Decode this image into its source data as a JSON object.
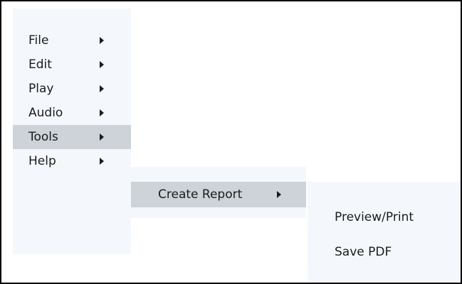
{
  "menu": {
    "items": [
      {
        "label": "File",
        "has_submenu": true
      },
      {
        "label": "Edit",
        "has_submenu": true
      },
      {
        "label": "Play",
        "has_submenu": true
      },
      {
        "label": "Audio",
        "has_submenu": true
      },
      {
        "label": "Tools",
        "has_submenu": true,
        "active": true
      },
      {
        "label": "Help",
        "has_submenu": true
      }
    ]
  },
  "tools_submenu": {
    "items": [
      {
        "label": "Create Report",
        "has_submenu": true,
        "active": true
      }
    ]
  },
  "report_submenu": {
    "items": [
      {
        "label": "Preview/Print"
      },
      {
        "label": "Save PDF"
      }
    ]
  },
  "colors": {
    "menu_bg": "#f4f8fc",
    "highlight": "#cdd3d8",
    "frame_border": "#000000"
  },
  "icons": {
    "submenu_indicator": "caret-right-icon"
  }
}
